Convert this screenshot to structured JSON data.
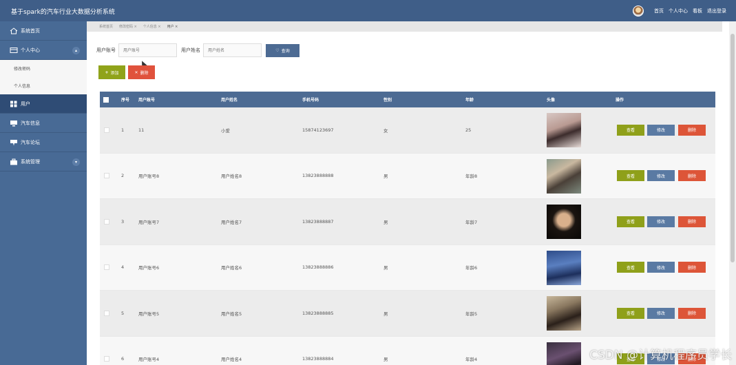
{
  "header": {
    "title": "基于spark的汽车行业大数据分析系统",
    "links": [
      "首页",
      "个人中心",
      "看板",
      "退出登录"
    ]
  },
  "sidebar": {
    "items": [
      {
        "label": "系统首页",
        "icon": "home-icon"
      },
      {
        "label": "个人中心",
        "icon": "wallet-icon",
        "expanded": true,
        "children": [
          "修改密码",
          "个人信息"
        ]
      },
      {
        "label": "用户",
        "icon": "grid-icon",
        "active": true
      },
      {
        "label": "汽车信息",
        "icon": "monitor-icon"
      },
      {
        "label": "汽车论坛",
        "icon": "forum-icon"
      },
      {
        "label": "系统管理",
        "icon": "briefcase-icon",
        "expandable": true
      }
    ]
  },
  "breadcrumb": [
    "系统首页",
    "修改密码 ×",
    "个人信息 ×",
    "用户 ×"
  ],
  "search": {
    "account_label": "用户账号",
    "account_placeholder": "用户账号",
    "name_label": "用户姓名",
    "name_placeholder": "用户姓名",
    "button": "查询"
  },
  "actions": {
    "add": "添加",
    "delete": "删除"
  },
  "table": {
    "headers": [
      "序号",
      "用户账号",
      "用户姓名",
      "手机号码",
      "性别",
      "年龄",
      "头像",
      "操作"
    ],
    "row_buttons": {
      "view": "查看",
      "edit": "修改",
      "delete": "删除"
    },
    "rows": [
      {
        "no": "1",
        "account": "11",
        "name": "小爱",
        "phone": "15874123697",
        "gender": "女",
        "age": "25"
      },
      {
        "no": "2",
        "account": "用户账号8",
        "name": "用户姓名8",
        "phone": "13823888888",
        "gender": "男",
        "age": "年龄8"
      },
      {
        "no": "3",
        "account": "用户账号7",
        "name": "用户姓名7",
        "phone": "13823888887",
        "gender": "男",
        "age": "年龄7"
      },
      {
        "no": "4",
        "account": "用户账号6",
        "name": "用户姓名6",
        "phone": "13823888886",
        "gender": "男",
        "age": "年龄6"
      },
      {
        "no": "5",
        "account": "用户账号5",
        "name": "用户姓名5",
        "phone": "13823888885",
        "gender": "男",
        "age": "年龄5"
      },
      {
        "no": "6",
        "account": "用户账号4",
        "name": "用户姓名4",
        "phone": "13823888884",
        "gender": "男",
        "age": "年龄4"
      }
    ]
  },
  "watermark": "CSDN @计算机程序员学长",
  "colors": {
    "header": "#3f5e88",
    "sidebar": "#486a95",
    "table_header": "#4d6b93",
    "view_button": "#8fa01a",
    "edit_button": "#5a7aa3",
    "delete_button": "#dd5538"
  }
}
